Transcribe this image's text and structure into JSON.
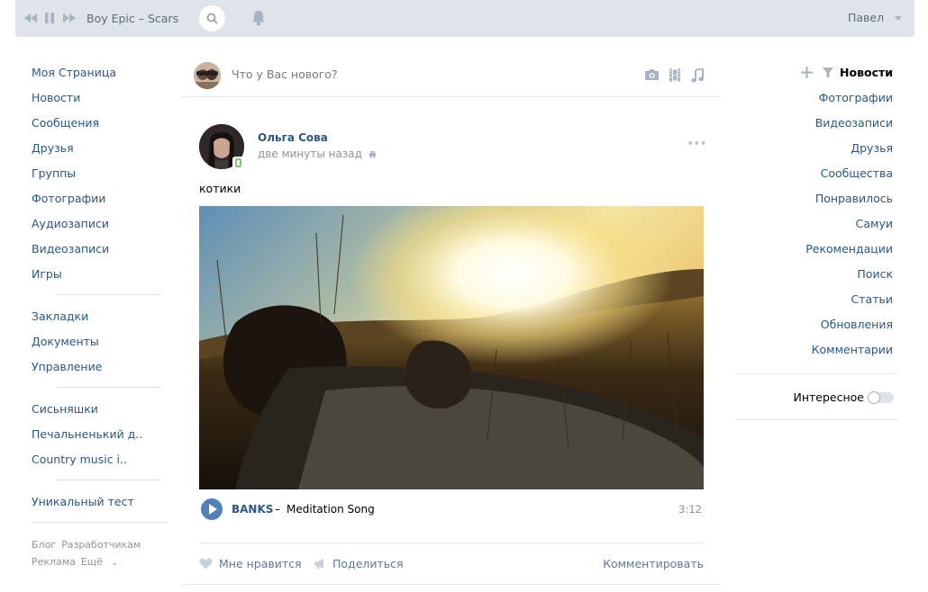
{
  "player": {
    "track": "Boy Epic – Scars",
    "user": "Павел"
  },
  "left_nav": {
    "group1": [
      "Моя Страница",
      "Новости",
      "Сообщения",
      "Друзья",
      "Группы",
      "Фотографии",
      "Аудиозаписи",
      "Видеозаписи",
      "Игры"
    ],
    "group2": [
      "Закладки",
      "Документы",
      "Управление"
    ],
    "group3": [
      "Сисьняшки",
      "Печальненький д..",
      "Country music i.."
    ],
    "group4": [
      "Уникальный тест"
    ],
    "footer": [
      "Блог",
      "Разработчикам",
      "Реклама",
      "Ещё"
    ]
  },
  "composer": {
    "placeholder": "Что у Вас нового?"
  },
  "post": {
    "author": "Ольга Сова",
    "time": "две минуты назад",
    "text": "котики",
    "audio": {
      "artist": "BANKS",
      "dash": "–",
      "title": "Meditation Song",
      "duration": "3:12"
    },
    "actions": {
      "like": "Мне нравится",
      "share": "Поделиться",
      "comment": "Комментировать"
    }
  },
  "right_menu": {
    "header": "Новости",
    "items": [
      "Фотографии",
      "Видеозаписи",
      "Друзья",
      "Сообщества",
      "Понравилось",
      "Самуи",
      "Рекомендации",
      "Поиск",
      "Статьи",
      "Обновления",
      "Комментарии"
    ],
    "toggle_label": "Интересное",
    "toggle_on": false
  },
  "colors": {
    "link": "#2a5885",
    "topbar": "#dfe4ea",
    "accent": "#5181b8"
  }
}
